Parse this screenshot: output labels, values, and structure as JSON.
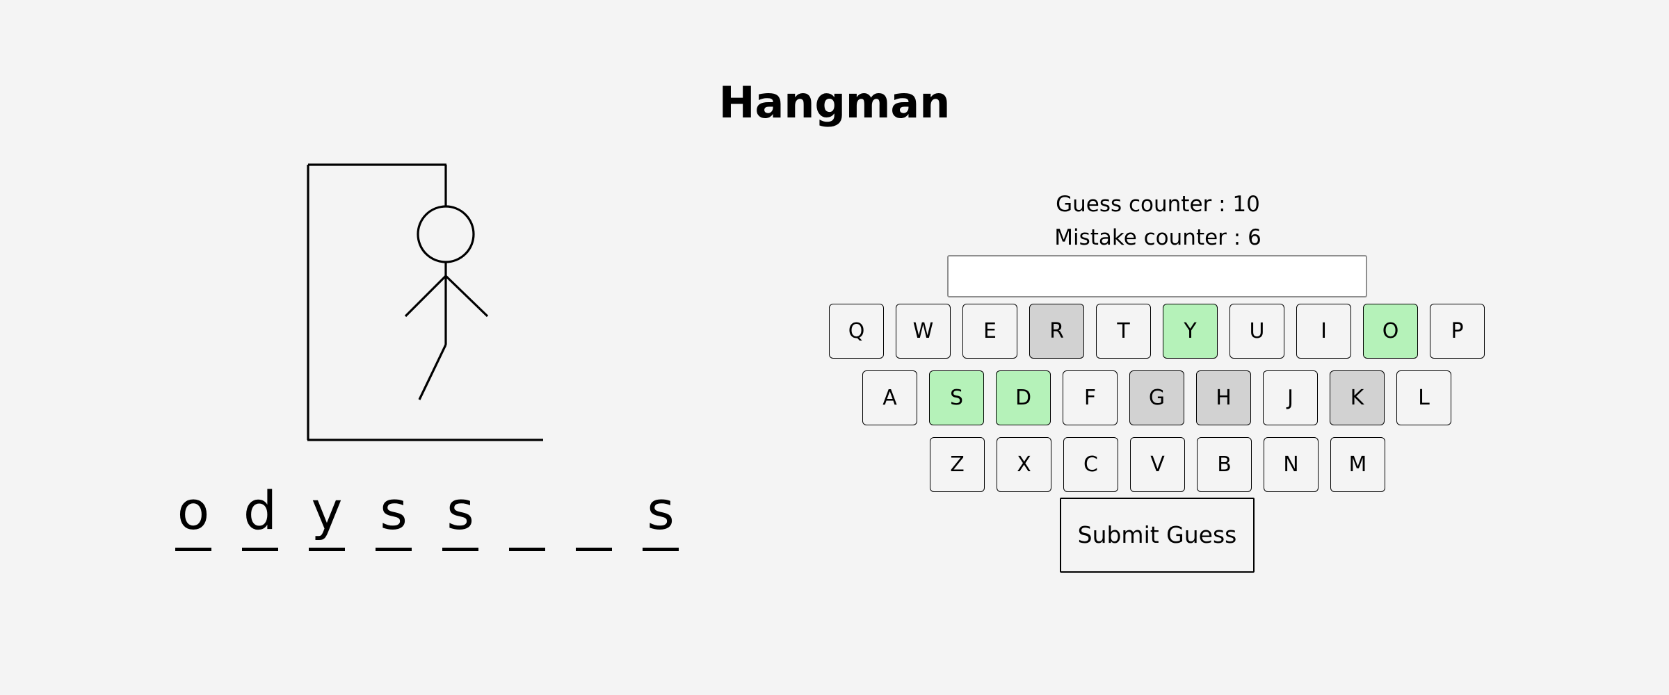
{
  "title": "Hangman",
  "word": {
    "letters": [
      "o",
      "d",
      "y",
      "s",
      "s",
      "",
      "",
      "s"
    ]
  },
  "counters": {
    "guess": "Guess counter : 10",
    "mistake": "Mistake counter : 6"
  },
  "guess_input": {
    "value": "",
    "placeholder": ""
  },
  "keyboard": {
    "rows": [
      [
        {
          "letter": "Q",
          "state": "unused"
        },
        {
          "letter": "W",
          "state": "unused"
        },
        {
          "letter": "E",
          "state": "unused"
        },
        {
          "letter": "R",
          "state": "wrong"
        },
        {
          "letter": "T",
          "state": "unused"
        },
        {
          "letter": "Y",
          "state": "correct"
        },
        {
          "letter": "U",
          "state": "unused"
        },
        {
          "letter": "I",
          "state": "unused"
        },
        {
          "letter": "O",
          "state": "correct"
        },
        {
          "letter": "P",
          "state": "unused"
        }
      ],
      [
        {
          "letter": "A",
          "state": "unused"
        },
        {
          "letter": "S",
          "state": "correct"
        },
        {
          "letter": "D",
          "state": "correct"
        },
        {
          "letter": "F",
          "state": "unused"
        },
        {
          "letter": "G",
          "state": "wrong"
        },
        {
          "letter": "H",
          "state": "wrong"
        },
        {
          "letter": "J",
          "state": "unused"
        },
        {
          "letter": "K",
          "state": "wrong"
        },
        {
          "letter": "L",
          "state": "unused"
        }
      ],
      [
        {
          "letter": "Z",
          "state": "unused"
        },
        {
          "letter": "X",
          "state": "unused"
        },
        {
          "letter": "C",
          "state": "unused"
        },
        {
          "letter": "V",
          "state": "unused"
        },
        {
          "letter": "B",
          "state": "unused"
        },
        {
          "letter": "N",
          "state": "unused"
        },
        {
          "letter": "M",
          "state": "unused"
        }
      ]
    ],
    "colors": {
      "correct": "#b5f2b9",
      "wrong": "#d2d2d2",
      "unused": "#f4f4f4"
    }
  },
  "submit_label": "Submit Guess",
  "colors": {
    "background": "#f4f4f4",
    "ink": "#000000"
  }
}
